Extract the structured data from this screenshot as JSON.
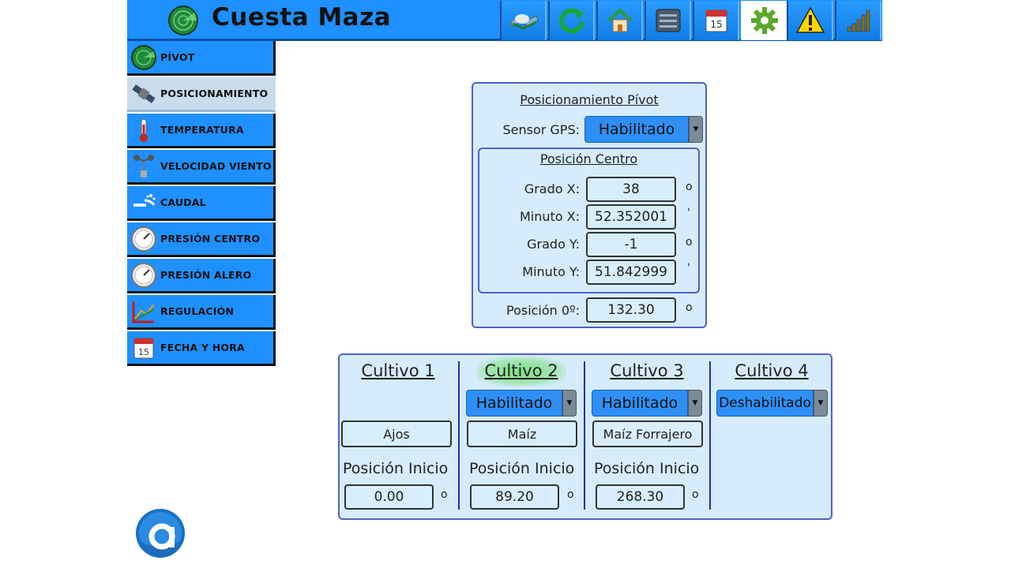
{
  "header": {
    "title": "Cuesta Maza",
    "toolbar": [
      {
        "name": "map-icon"
      },
      {
        "name": "refresh-icon"
      },
      {
        "name": "home-icon"
      },
      {
        "name": "list-icon"
      },
      {
        "name": "calendar-icon"
      },
      {
        "name": "gear-icon",
        "active": true
      },
      {
        "name": "warning-icon"
      },
      {
        "name": "signal-icon"
      }
    ]
  },
  "sidebar": {
    "items": [
      {
        "label": "PÍVOT",
        "icon": "radar-icon"
      },
      {
        "label": "POSICIONAMIENTO",
        "icon": "satellite-icon",
        "selected": true
      },
      {
        "label": "TEMPERATURA",
        "icon": "thermometer-icon"
      },
      {
        "label": "VELOCIDAD VIENTO",
        "icon": "anemometer-icon"
      },
      {
        "label": "CAUDAL",
        "icon": "water-icon"
      },
      {
        "label": "PRESIÓN CENTRO",
        "icon": "gauge-icon"
      },
      {
        "label": "PRESIÓN ALERO",
        "icon": "gauge-icon"
      },
      {
        "label": "REGULACIÓN",
        "icon": "chart-icon"
      },
      {
        "label": "FECHA Y HORA",
        "icon": "calendar-icon"
      }
    ]
  },
  "positioning": {
    "title": "Posicionamiento Pívot",
    "gps_label": "Sensor GPS:",
    "gps_value": "Habilitado",
    "center": {
      "title": "Posición Centro",
      "rows": [
        {
          "label": "Grado X:",
          "value": "38",
          "unit": "o"
        },
        {
          "label": "Minuto X:",
          "value": "52.352001",
          "unit": "'"
        },
        {
          "label": "Grado Y:",
          "value": "-1",
          "unit": "o"
        },
        {
          "label": "Minuto Y:",
          "value": "51.842999",
          "unit": "'"
        }
      ]
    },
    "zero_label": "Posición 0º:",
    "zero_value": "132.30",
    "zero_unit": "o"
  },
  "crops": {
    "start_label": "Posición Inicio",
    "unit": "o",
    "items": [
      {
        "title": "Cultivo 1",
        "state": "",
        "name": "Ajos",
        "start": "0.00"
      },
      {
        "title": "Cultivo 2",
        "state": "Habilitado",
        "name": "Maíz",
        "start": "89.20",
        "highlight": true
      },
      {
        "title": "Cultivo 3",
        "state": "Habilitado",
        "name": "Maíz Forrajero",
        "start": "268.30"
      },
      {
        "title": "Cultivo 4",
        "state": "Deshabilitado",
        "name": "",
        "start": ""
      }
    ]
  },
  "colors": {
    "accent": "#1e90ff",
    "panel": "#d6ecfc",
    "panel_border": "#4b62c7",
    "highlight": "#7ee07e"
  }
}
